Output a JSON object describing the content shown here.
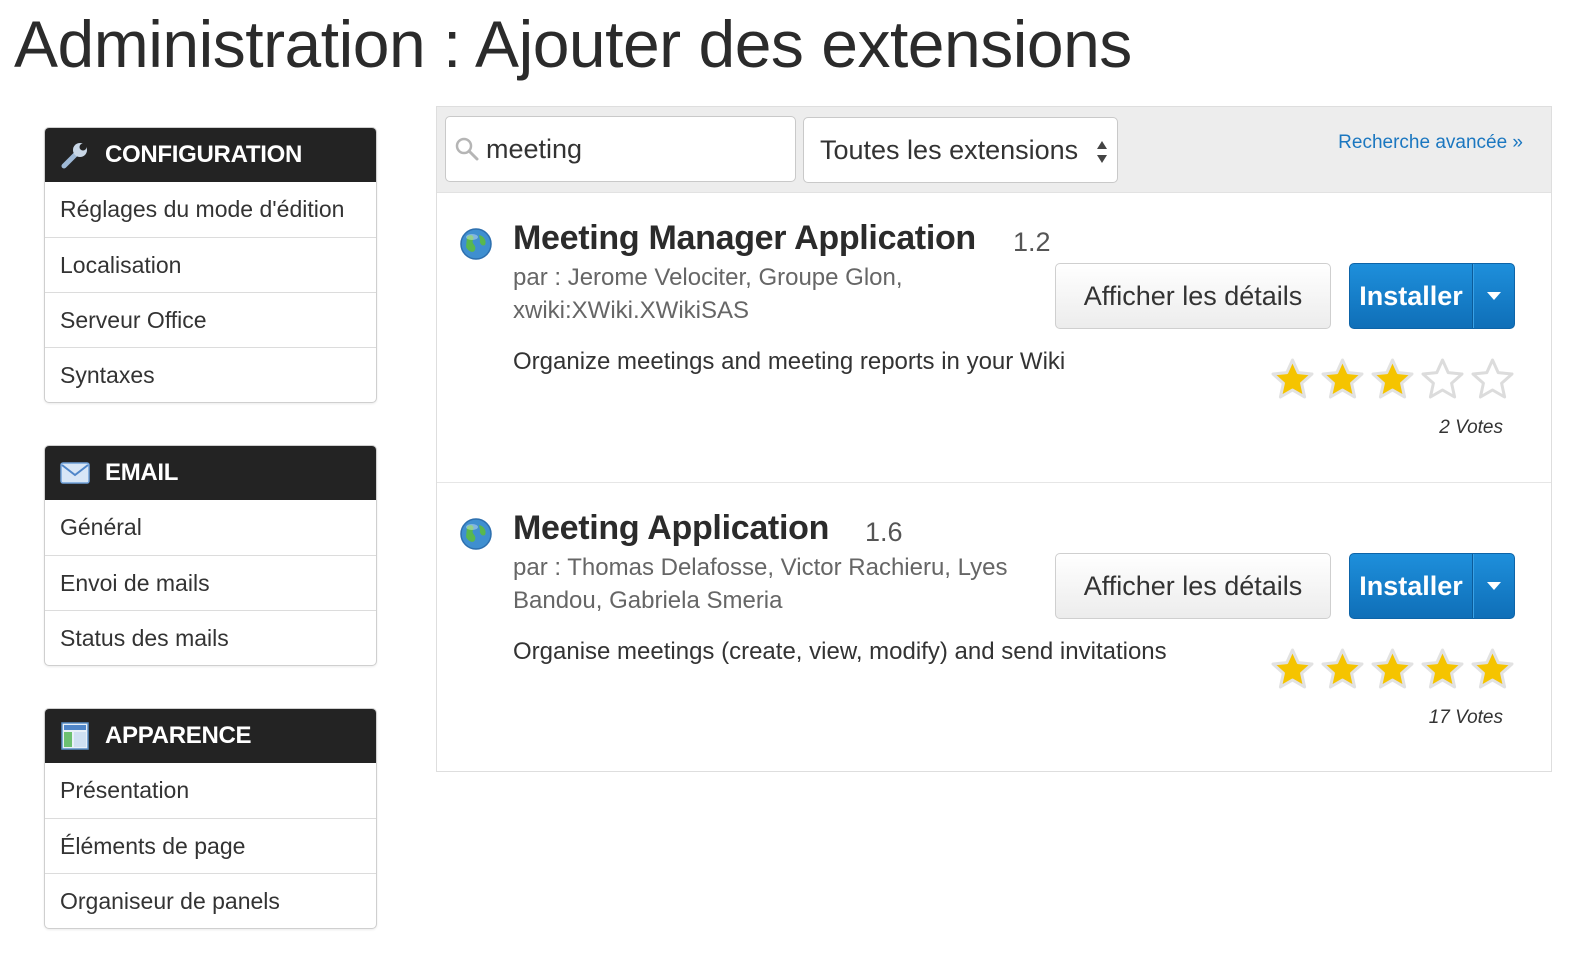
{
  "page": {
    "title": "Administration : Ajouter des extensions"
  },
  "sidebar": {
    "sections": [
      {
        "title": "CONFIGURATION",
        "icon": "wrench-icon",
        "items": [
          "Réglages du mode d'édition",
          "Localisation",
          "Serveur Office",
          "Syntaxes"
        ]
      },
      {
        "title": "EMAIL",
        "icon": "envelope-icon",
        "items": [
          "Général",
          "Envoi de mails",
          "Status des mails"
        ]
      },
      {
        "title": "APPARENCE",
        "icon": "layout-icon",
        "items": [
          "Présentation",
          "Éléments de page",
          "Organiseur de panels"
        ]
      }
    ]
  },
  "search": {
    "query": "meeting",
    "filter_selected": "Toutes les extensions",
    "advanced_link": "Recherche avancée »"
  },
  "extensions": [
    {
      "name": "Meeting Manager Application",
      "version": "1.2",
      "authors": "par : Jerome Velociter, Groupe Glon, xwiki:XWiki.XWikiSAS",
      "description": "Organize meetings and meeting reports in your Wiki",
      "details_label": "Afficher les détails",
      "install_label": "Installer",
      "rating": 3,
      "rating_max": 5,
      "votes": "2 Votes"
    },
    {
      "name": "Meeting Application",
      "version": "1.6",
      "authors": "par : Thomas Delafosse, Victor Rachieru, Lyes Bandou, Gabriela Smeria",
      "description": "Organise meetings (create, view, modify) and send invitations",
      "details_label": "Afficher les détails",
      "install_label": "Installer",
      "rating": 5,
      "rating_max": 5,
      "votes": "17 Votes"
    }
  ],
  "colors": {
    "panel_header": "#232323",
    "install_button": "#1580cc",
    "link": "#1b77c0",
    "star_filled": "#f5c400"
  }
}
